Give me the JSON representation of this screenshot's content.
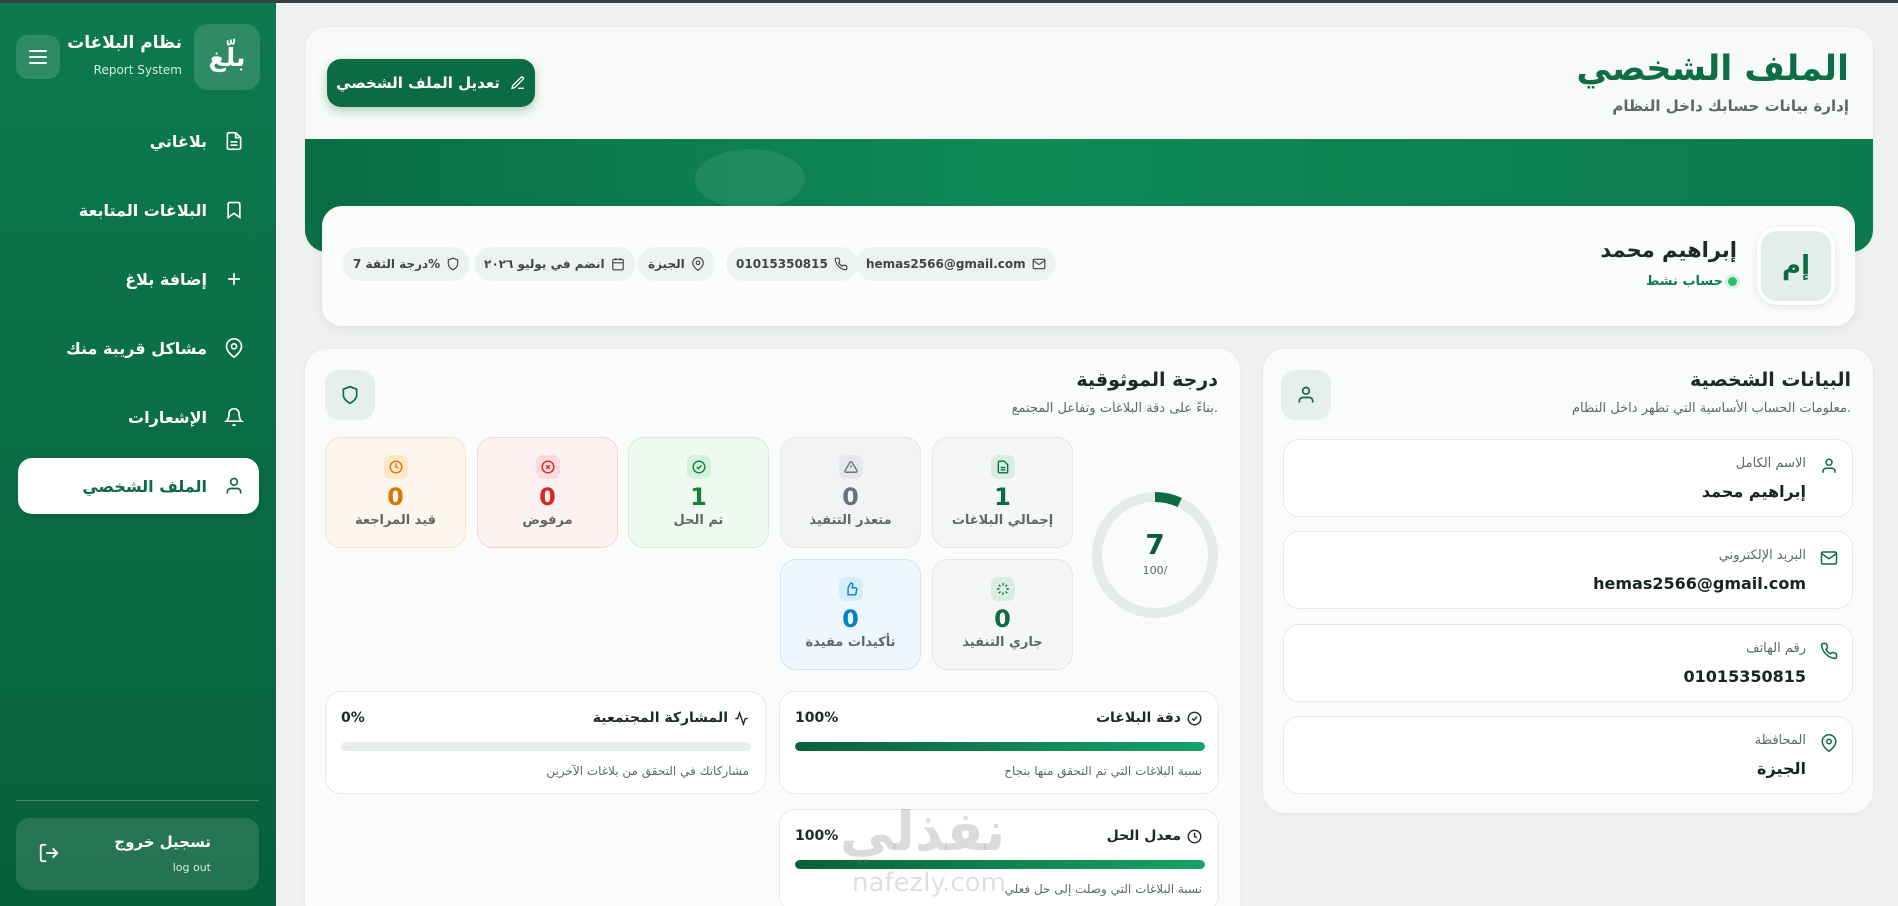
{
  "app": {
    "title": "نظام البلاغات",
    "subtitle": "Report System",
    "logo": "بلّغ"
  },
  "sidebar": {
    "items": [
      {
        "label": "بلاغاتي",
        "icon": "file-icon"
      },
      {
        "label": "البلاغات المتابعة",
        "icon": "bookmark-icon"
      },
      {
        "label": "إضافة بلاغ",
        "icon": "plus-icon"
      },
      {
        "label": "مشاكل قريبة منك",
        "icon": "map-pin-icon"
      },
      {
        "label": "الإشعارات",
        "icon": "bell-icon"
      },
      {
        "label": "الملف الشخصي",
        "icon": "user-icon",
        "active": true
      }
    ],
    "logout": {
      "label": "تسجيل خروج",
      "sublabel": "log out"
    }
  },
  "header": {
    "title": "الملف الشخصي",
    "subtitle": "إدارة بيانات حسابك داخل النظام",
    "edit_button": "تعديل الملف الشخصي"
  },
  "profile": {
    "initials": "إم",
    "name": "إبراهيم محمد",
    "status": "حساب نشط",
    "chips": {
      "email": "hemas2566@gmail.com",
      "phone": "01015350815",
      "location": "الجيزة",
      "joined": "انضم في يوليو ٢٠٢٦",
      "trust": "درجة الثقة 7%"
    }
  },
  "personal": {
    "title": "البيانات الشخصية",
    "subtitle": "معلومات الحساب الأساسية التي تظهر داخل النظام.",
    "fields": [
      {
        "label": "الاسم الكامل",
        "value": "إبراهيم محمد"
      },
      {
        "label": "البريد الإلكتروني",
        "value": "hemas2566@gmail.com"
      },
      {
        "label": "رقم الهاتف",
        "value": "01015350815"
      },
      {
        "label": "المحافظة",
        "value": "الجيزة"
      }
    ]
  },
  "trust": {
    "title": "درجة الموثوقية",
    "subtitle": "بناءً على دقة البلاغات وتفاعل المجتمع.",
    "score": "7",
    "score_max": "100/",
    "score_fraction": 0.07,
    "stats": [
      {
        "label": "إجمالي البلاغات",
        "value": "1",
        "color": "#0c6b44"
      },
      {
        "label": "متعذر التنفيذ",
        "value": "0",
        "color": "#6b7280"
      },
      {
        "label": "تم الحل",
        "value": "1",
        "color": "#15803d"
      },
      {
        "label": "مرفوض",
        "value": "0",
        "color": "#dc2626"
      },
      {
        "label": "قيد المراجعة",
        "value": "0",
        "color": "#d97706"
      },
      {
        "label": "جاري التنفيذ",
        "value": "0",
        "color": "#0c6b44"
      },
      {
        "label": "تأكيدات مفيدة",
        "value": "0",
        "color": "#0284c7"
      }
    ],
    "metrics": [
      {
        "title": "دقة البلاغات",
        "pct": "100%",
        "fill": 1.0,
        "desc": "نسبة البلاغات التي تم التحقق منها بنجاح"
      },
      {
        "title": "المشاركة المجتمعية",
        "pct": "0%",
        "fill": 0.0,
        "desc": "مشاركاتك في التحقق من بلاغات الآخرين"
      },
      {
        "title": "معدل الحل",
        "pct": "100%",
        "fill": 1.0,
        "desc": "نسبة البلاغات التي وصلت إلى حل فعلي"
      }
    ]
  },
  "watermark": {
    "text": "نفذلي",
    "url": "nafezly.com"
  },
  "colors": {
    "primary": "#0c6b44",
    "sidebar": "#0d7a4e",
    "accent": "#16a36a"
  }
}
